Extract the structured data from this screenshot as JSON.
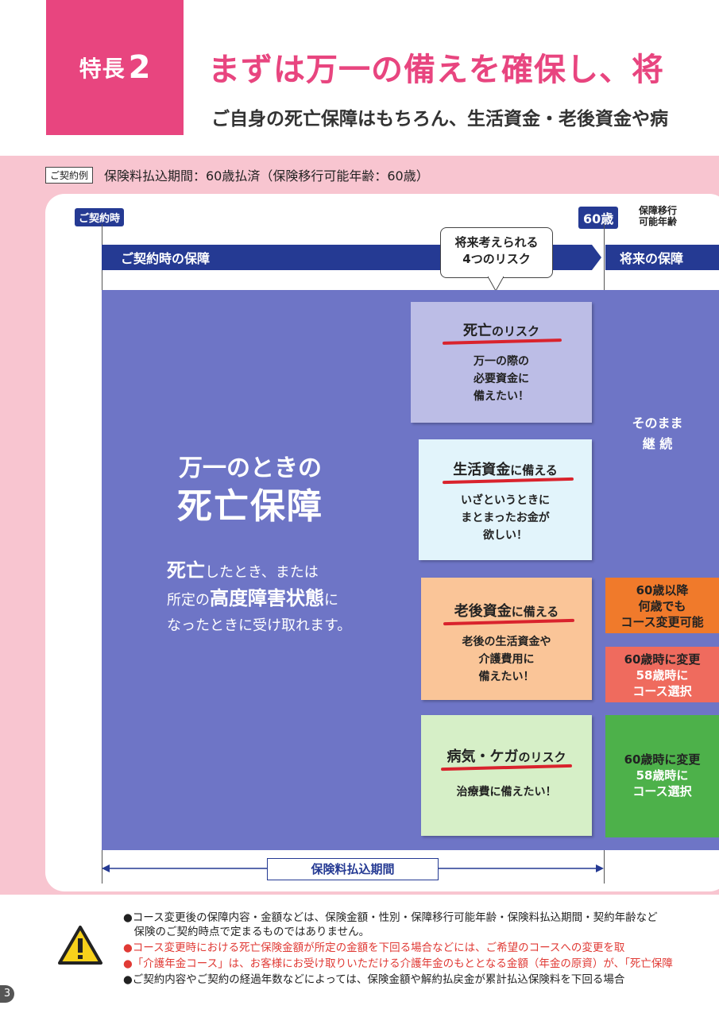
{
  "header": {
    "feature_label": "特長",
    "feature_number": "2",
    "headline": "まずは万一の備えを確保し、将",
    "subheadline": "ご自身の死亡保障はもちろん、生活資金・老後資金や病",
    "headline_color": "#e8457f"
  },
  "contract": {
    "tag": "ご契約例",
    "text": "保険料払込期間：60歳払済（保険移行可能年齢：60歳）"
  },
  "timeline": {
    "start_label": "ご契約時",
    "age_label": "60歳",
    "age_note_l1": "保障移行",
    "age_note_l2": "可能年齢",
    "band_left": "ご契約時の保障",
    "band_right": "将来の保障",
    "bubble_l1": "将来考えられる",
    "bubble_l2": "4つのリスク",
    "period_label": "保険料払込期間"
  },
  "main_coverage": {
    "title_l1": "万一のときの",
    "title_l2": "死亡保障",
    "desc_l1_a": "死亡",
    "desc_l1_b": "したとき、または",
    "desc_l2_a": "所定の",
    "desc_l2_b": "高度障害状態",
    "desc_l2_c": "に",
    "desc_l3": "なったときに受け取れます。"
  },
  "risks": [
    {
      "title_a": "死亡",
      "title_b": "のリスク",
      "desc": [
        "万一の際の",
        "必要資金に",
        "備えたい！"
      ],
      "color": "#bcbde6"
    },
    {
      "title_a": "生活資金",
      "title_b": "に備える",
      "desc": [
        "いざというときに",
        "まとまったお金が",
        "欲しい！"
      ],
      "color": "#e2f4fb"
    },
    {
      "title_a": "老後資金",
      "title_b": "に備える",
      "desc": [
        "老後の生活資金や",
        "介護費用に",
        "備えたい！"
      ],
      "color": "#fac598"
    },
    {
      "title_a": "病気・ケガ",
      "title_b": "のリスク",
      "desc": [
        "治療費に備えたい！"
      ],
      "color": "#d6efc7"
    }
  ],
  "future": {
    "continue_l1": "そのまま",
    "continue_l2": "継 続",
    "options": [
      {
        "lines": [
          "60歳以降",
          "何歳でも",
          "コース変更可能"
        ],
        "color": "#f07a2b"
      },
      {
        "lines": [
          "60歳時に変更",
          "58歳時に",
          "コース選択"
        ],
        "color": "#ef6b5e"
      },
      {
        "lines": [
          "60歳時に変更",
          "58歳時に",
          "コース選択"
        ],
        "color": "#4db14a"
      }
    ]
  },
  "notes": [
    "●コース変更後の保障内容・金額などは、保険金額・性別・保障移行可能年齢・保険料払込期間・契約年齢など",
    "　保険のご契約時点で定まるものではありません。",
    "●コース変更時における死亡保険金額が所定の金額を下回る場合などには、ご希望のコースへの変更を取",
    "●「介護年金コース」は、お客様にお受け取りいただける介護年金のもととなる金額（年金の原資）が、「死亡保障",
    "●ご契約内容やご契約の経過年数などによっては、保険金額や解約払戻金が累計払込保険料を下回る場合"
  ],
  "page_number": "3",
  "colors": {
    "navy": "#253a93",
    "purple": "#6e75c6",
    "pink_panel": "#f8c5d0",
    "red": "#e03a35"
  }
}
